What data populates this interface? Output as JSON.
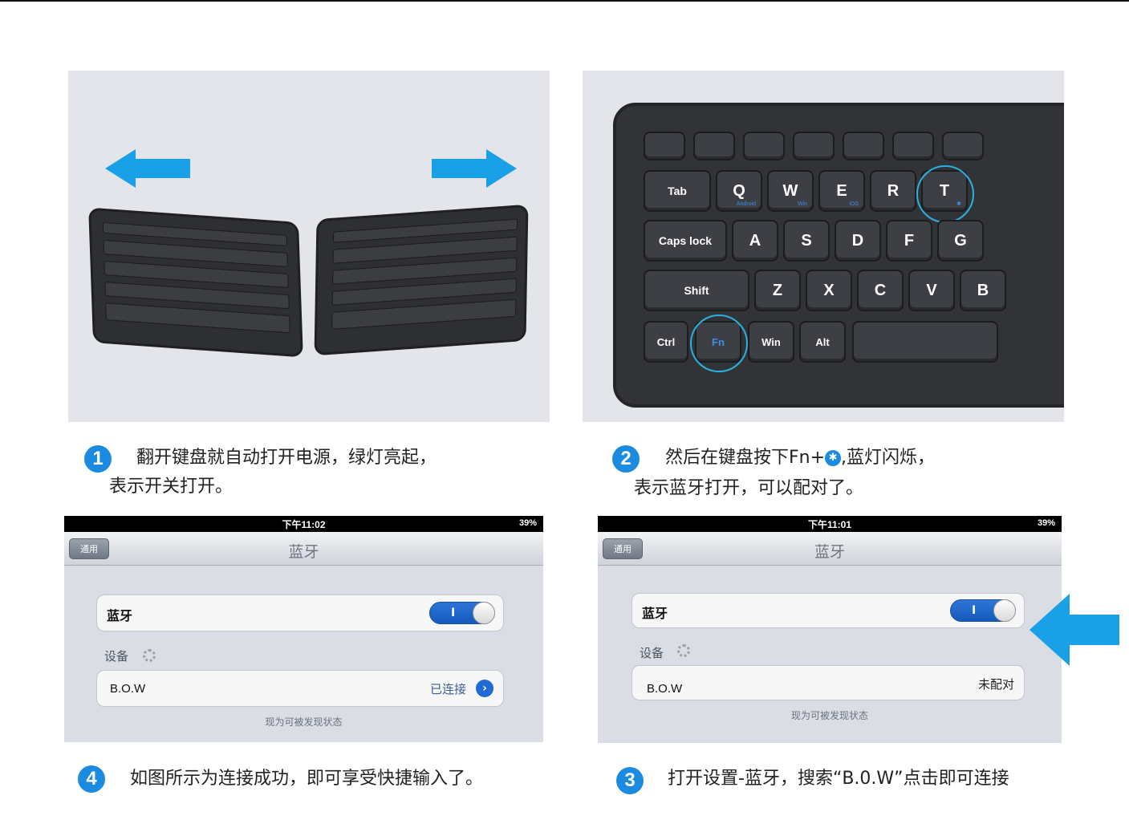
{
  "steps": {
    "step1": {
      "number": "1",
      "line1": "翻开键盘就自动打开电源，绿灯亮起，",
      "line2": "表示开关打开。"
    },
    "step2": {
      "number": "2",
      "line1_a": "然后在键盘按下Fn+",
      "line1_b": ",蓝灯闪烁，",
      "line2": "表示蓝牙打开，可以配对了。"
    },
    "step3": {
      "number": "3",
      "text": "打开设置-蓝牙，搜索“B.0.W”点击即可连接"
    },
    "step4": {
      "number": "4",
      "text": "如图所示为连接成功，即可享受快捷输入了。"
    }
  },
  "keyboard_closeup": {
    "keys": {
      "tab": "Tab",
      "q": "Q",
      "w": "W",
      "e": "E",
      "r": "R",
      "t": "T",
      "caps": "Caps lock",
      "a": "A",
      "s": "S",
      "d": "D",
      "f": "F",
      "g": "G",
      "shift": "Shift",
      "z": "Z",
      "x": "X",
      "c": "C",
      "v": "V",
      "b": "B",
      "ctrl": "Ctrl",
      "fn": "Fn",
      "win": "Win",
      "alt": "Alt"
    },
    "sublabels": {
      "q": "Android",
      "w": "Win",
      "e": "iOS"
    }
  },
  "ipad_connected": {
    "status_time": "下午11:02",
    "battery": "39%",
    "back_label": "通用",
    "nav_title": "蓝牙",
    "bluetooth_label": "蓝牙",
    "toggle_mark": "I",
    "devices_header": "设备",
    "device_name": "B.O.W",
    "device_status": "已连接",
    "footer": "现为可被发现状态"
  },
  "ipad_unpaired": {
    "status_time": "下午11:01",
    "battery": "39%",
    "back_label": "通用",
    "nav_title": "蓝牙",
    "bluetooth_label": "蓝牙",
    "toggle_mark": "I",
    "devices_header": "设备",
    "device_name": "B.O.W",
    "device_status": "未配对",
    "footer": "现为可被发现状态"
  },
  "colors": {
    "accent_blue": "#1a8be0",
    "arrow_blue": "#1aa0e6",
    "highlight_ring": "#2bb0e0",
    "ios_toggle": "#1f6bd3"
  },
  "icons": [
    "left-arrow-icon",
    "right-arrow-icon",
    "bluetooth-icon",
    "spinner-icon",
    "disclosure-icon",
    "pointer-arrow-icon"
  ]
}
